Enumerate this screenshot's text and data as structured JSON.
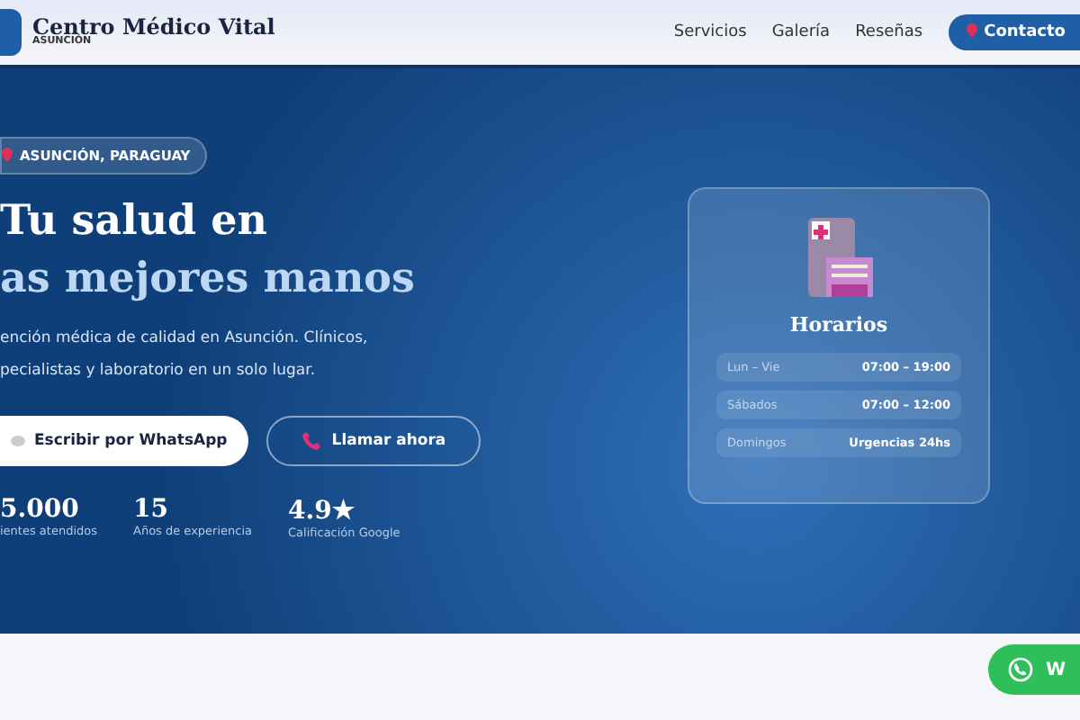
{
  "header": {
    "brand": "Centro Médico Vital",
    "brand_sub": "ASUNCIÓN",
    "nav": [
      {
        "label": "Servicios"
      },
      {
        "label": "Galería"
      },
      {
        "label": "Reseñas"
      }
    ],
    "cta": "Contacto"
  },
  "hero": {
    "location": "ASUNCIÓN, PARAGUAY",
    "title_line1": "Tu salud en",
    "title_line2": "as mejores manos",
    "description_line1": "ención médica de calidad en Asunción. Clínicos,",
    "description_line2": "pecialistas y laboratorio en un solo lugar.",
    "buttons": [
      {
        "kind": "primary",
        "label": "Escribir por WhatsApp"
      },
      {
        "kind": "outline",
        "label": "Llamar ahora"
      }
    ],
    "stats": [
      {
        "value": "5.000",
        "label": "ientes atendidos"
      },
      {
        "value": "15",
        "label": "Años de experiencia"
      },
      {
        "value": "4.9★",
        "label": "Calificación Google"
      }
    ]
  },
  "hours_card": {
    "title": "Horarios",
    "rows": [
      {
        "day": "Lun – Vie",
        "hours": "07:00 – 19:00"
      },
      {
        "day": "Sábados",
        "hours": "07:00 – 12:00"
      },
      {
        "day": "Domingos",
        "hours": "Urgencias 24hs"
      }
    ]
  },
  "floating_button": {
    "label": "W"
  }
}
